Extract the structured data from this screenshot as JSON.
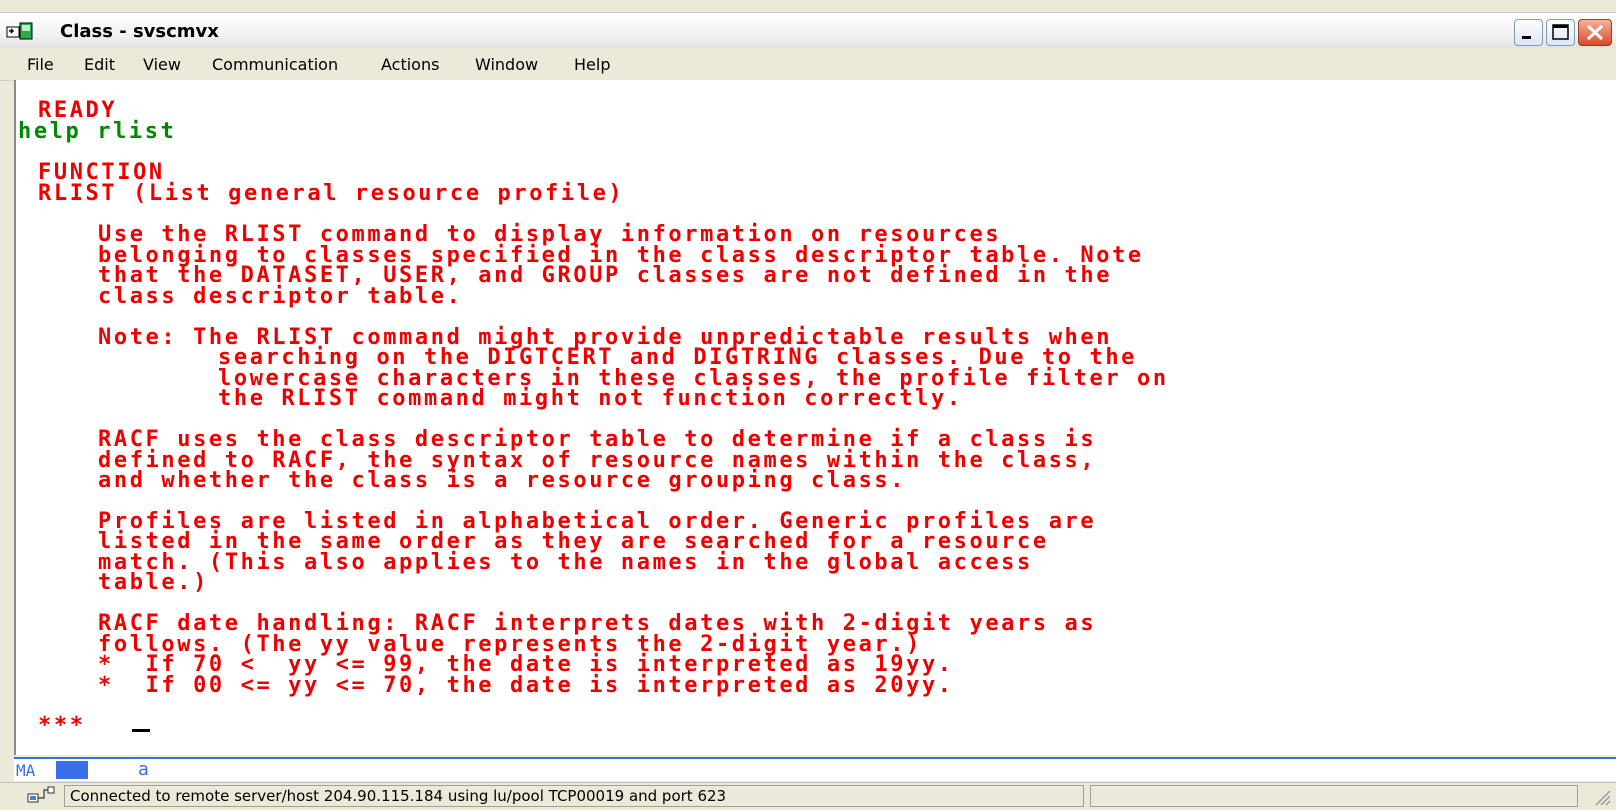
{
  "window": {
    "title": "Class - svscmvx",
    "icon": "terminal-session-icon",
    "controls": [
      "minimize-icon",
      "maximize-icon",
      "close-icon"
    ]
  },
  "menu": [
    "File",
    "Edit",
    "View",
    "Communication",
    "Actions",
    "Window",
    "Help"
  ],
  "terminal": {
    "colors": {
      "output": "#ee0000",
      "input": "#008800"
    },
    "lines": [
      "READY",
      "help rlist",
      "FUNCTION",
      "RLIST (List general resource profile)",
      "Use the RLIST command to display information on resources",
      "belonging to classes specified in the class descriptor table. Note",
      "that the DATASET, USER, and GROUP classes are not defined in the",
      "class descriptor table.",
      "Note: The RLIST command might provide unpredictable results when",
      "searching on the DIGTCERT and DIGTRING classes. Due to the",
      "lowercase characters in these classes, the profile filter on",
      "the RLIST command might not function correctly.",
      "RACF uses the class descriptor table to determine if a class is",
      "defined to RACF, the syntax of resource names within the class,",
      "and whether the class is a resource grouping class.",
      "Profiles are listed in alphabetical order. Generic profiles are",
      "listed in the same order as they are searched for a resource",
      "match. (This also applies to the names in the global access",
      "table.)",
      "RACF date handling: RACF interprets dates with 2-digit years as",
      "follows. (The yy value represents the 2-digit year.)",
      "*  If 70 <  yy <= 99, the date is interpreted as 19yy.",
      "*  If 00 <= yy <= 70, the date is interpreted as 20yy.",
      "***"
    ]
  },
  "oia": {
    "mode": "MA",
    "indicator": "a"
  },
  "status": {
    "icon": "network-connection-icon",
    "text": "Connected to remote server/host 204.90.115.184 using lu/pool TCP00019 and port 623"
  }
}
